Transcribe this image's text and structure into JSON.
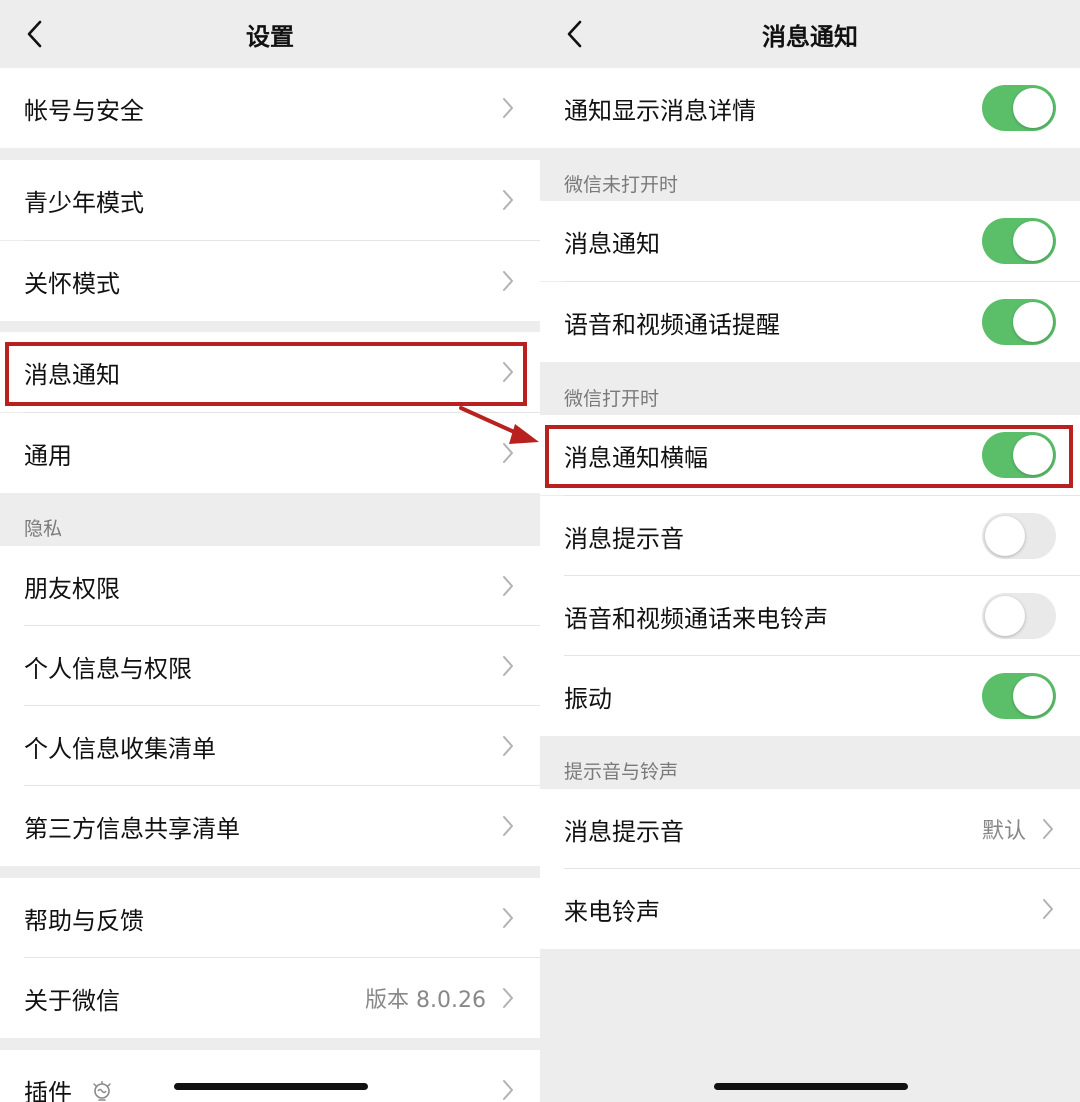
{
  "left": {
    "title": "设置",
    "section_privacy": "隐私",
    "items": [
      {
        "label": "帐号与安全"
      },
      {
        "label": "青少年模式"
      },
      {
        "label": "关怀模式"
      },
      {
        "label": "消息通知"
      },
      {
        "label": "通用"
      },
      {
        "label": "朋友权限"
      },
      {
        "label": "个人信息与权限"
      },
      {
        "label": "个人信息收集清单"
      },
      {
        "label": "第三方信息共享清单"
      },
      {
        "label": "帮助与反馈"
      },
      {
        "label": "关于微信",
        "value": "版本 8.0.26"
      },
      {
        "label": "插件"
      }
    ]
  },
  "right": {
    "title": "消息通知",
    "section_closed": "微信未打开时",
    "section_open": "微信打开时",
    "section_sound": "提示音与铃声",
    "items": [
      {
        "label": "通知显示消息详情",
        "toggle": "on"
      },
      {
        "label": "消息通知",
        "toggle": "on"
      },
      {
        "label": "语音和视频通话提醒",
        "toggle": "on"
      },
      {
        "label": "消息通知横幅",
        "toggle": "on"
      },
      {
        "label": "消息提示音",
        "toggle": "off"
      },
      {
        "label": "语音和视频通话来电铃声",
        "toggle": "off"
      },
      {
        "label": "振动",
        "toggle": "on"
      },
      {
        "label": "消息提示音",
        "value": "默认"
      },
      {
        "label": "来电铃声"
      }
    ]
  },
  "colors": {
    "toggle_on": "#5bbf6a",
    "toggle_off": "#e9e9ea",
    "highlight": "#b8211f",
    "background": "#ededed"
  },
  "icons": {
    "back": "chevron-left-icon",
    "row_arrow": "chevron-right-icon",
    "plugin": "lightbulb-icon",
    "annotation": "red-arrow-icon"
  }
}
